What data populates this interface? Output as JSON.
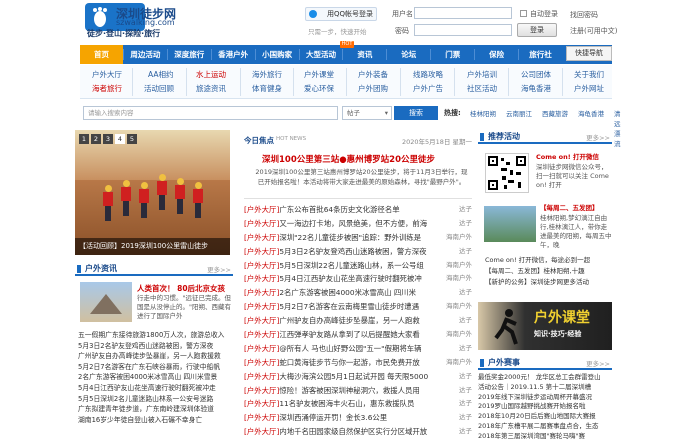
{
  "header": {
    "logo_name": "深圳徒步网",
    "logo_url": "szwalking.com",
    "slogan": "徒步·登山·探险·旅行",
    "qq_login": "用QQ帐号登录",
    "login_note": "只需一步，快速开始",
    "username_label": "用户名",
    "password_label": "密码",
    "auto_login": "自动登录",
    "login_btn": "登录",
    "find_pwd": "找回密码",
    "register": "注册(可用中文)"
  },
  "nav": {
    "items": [
      "首页",
      "周边活动",
      "深度旅行",
      "香港户外",
      "小国购家",
      "大型活动",
      "资讯",
      "论坛",
      "门票",
      "保险",
      "旅行社"
    ],
    "hot_badge": "HOT",
    "quick": "快捷导航"
  },
  "subnav": {
    "c1": [
      "户外大厅",
      "海者旅行"
    ],
    "c2": [
      "AA相约",
      "活动回顾"
    ],
    "c3": [
      "水上运动",
      "旅途资讯"
    ],
    "c4": [
      "海外旅行",
      "体育健身"
    ],
    "c5": [
      "户外课堂",
      "爱心环保"
    ],
    "c6": [
      "户外装备",
      "户外团购"
    ],
    "c7": [
      "线路攻略",
      "户外广告"
    ],
    "c8": [
      "户外培训",
      "社区活动"
    ],
    "c9": [
      "公司团体",
      "海龟香港"
    ],
    "c10": [
      "关于我们",
      "户外网址"
    ]
  },
  "search": {
    "placeholder": "请输入搜索内容",
    "select": "帖子",
    "button": "搜索",
    "hot_label": "热搜:",
    "hot": [
      "桂林阳朔",
      "云南丽江",
      "西藏旅游",
      "海龟香港",
      "清远漂流"
    ]
  },
  "slideshow": {
    "pages": [
      "1",
      "2",
      "3",
      "4",
      "5"
    ],
    "caption": "【活动回顾】2019深圳100公里雷山徒步"
  },
  "outdoor_news": {
    "title": "户外资讯",
    "more": "更多>>",
    "featured_title": "人类首次！ 80后北京女孩",
    "featured_sum": "行走中的习惯。\"远征已完成。但国是从没停止的。\"阳朔、西藏有进行了国际户外",
    "list": [
      "五一假期广东接待旅游1800万人次，旅游总收入",
      "5月3日2名驴友登鸡西山迷路被困，警方深夜",
      "广州驴友自办高峰徒步坠暴崖，另一人跑救援救",
      "5月2日7名游客在广东石峡谷暴雨，行驶中船帆",
      "2名广东游客被困4000米冰雪高山 四川米雪景",
      "5月4日江西驴友山花坐高速行驶时翻死被冲走",
      "5月5日深圳2名儿童迷路山林系一公安号迷路",
      "广东拟建青年徒步道，广东南岭建深圳体验道",
      "湖南16岁少年徒自登山被入石碾不幸身亡"
    ]
  },
  "focus": {
    "title": "今日焦点",
    "hot": "HOT NEWS",
    "date": "2020年5月18日 星期一",
    "headline": "深圳100公里第三站●惠州博罗站20公里徒步",
    "summary": "2019深圳100公里第三站惠州博罗站20公里徒步，将于11月3日举行，现已开始报名啦！本活动将带大家走进最美的原始森林，寻找\"最野户外\"。",
    "list": [
      {
        "tag": "[户外大厅]",
        "text": "广东公布首批64条历史文化游径名单",
        "src": "达子"
      },
      {
        "tag": "[户外大厅]",
        "text": "又一海边打卡地，风景绝美，但不方便，前海",
        "src": "达子"
      },
      {
        "tag": "[户外大厅]",
        "text": "深圳\"22名儿童徒步被困\"追踪：野外训练是",
        "src": "海南户外"
      },
      {
        "tag": "[户外大厅]",
        "text": "5月3日2名驴友登鸡西山迷路被困，警方深夜",
        "src": "达子"
      },
      {
        "tag": "[户外大厅]",
        "text": "5月5日深圳22名儿童迷路山林，系一公号组",
        "src": "海南户外"
      },
      {
        "tag": "[户外大厅]",
        "text": "5月4日江西驴友山花坐高速行驶时翻死被冲",
        "src": "海南户外"
      },
      {
        "tag": "[户外大厅]",
        "text": "2名广东游客被困4000米冰雪高山 四川米",
        "src": "达子"
      },
      {
        "tag": "[户外大厅]",
        "text": "5月2日7名游客在云南梅里雪山徒步时遭遇",
        "src": "海南户外"
      },
      {
        "tag": "[户外大厅]",
        "text": "广州驴友自办高峰徒步坠暴崖，另一人跑救",
        "src": "达子"
      },
      {
        "tag": "[户外大厅]",
        "text": "江西弹孝驴友路从拿到了以后提醒她大家看",
        "src": "海南户外"
      },
      {
        "tag": "[户外大厅]",
        "text": "@所有人 马也山好野公园\"五一\"假期将车辆",
        "src": "达子"
      },
      {
        "tag": "[户外大厅]",
        "text": "蛇口黄海徒步节与你一起游，市民免费开放",
        "src": "海南户外"
      },
      {
        "tag": "[户外大厅]",
        "text": "大梅沙海滨公园5月1日起试开园 每天限5000",
        "src": "达子"
      },
      {
        "tag": "[户外大厅]",
        "text": "惊险！游客被困深圳神秘洞穴，救援人员用",
        "src": "达子"
      },
      {
        "tag": "[户外大厅]",
        "text": "11名驴友被困海丰火石山，惠东救援队员",
        "src": "达子"
      },
      {
        "tag": "[户外大厅]",
        "text": "深圳西涌停运开罚！金长3.6公里",
        "src": "达子"
      },
      {
        "tag": "[户外大厅]",
        "text": "内地千名田园家级自然保护区实行分区域开放",
        "src": "达子"
      }
    ]
  },
  "recommend": {
    "title": "推荐活动",
    "more": "更多>>",
    "qr_title": "Come on! 打开微信",
    "qr_text": "深圳徒步网微信公众号，扫一扫就可以关注 Come on! 打开",
    "act_title": "【每周二、五发团】",
    "act_text": "桂林阳朔,梦幻漓江自由行,桂林漓江人，带你走进最美的阳朔，每周五中午，晚",
    "list": [
      "Come on!  打开微信，每途必到一超",
      "【每周二、五发团】桂林阳朔,十趣",
      "【新护的公务】深圳徒步网更多活动"
    ]
  },
  "banner": {
    "title": "户外课堂",
    "sub": "知识·技巧·经验"
  },
  "events": {
    "title": "户外赛事",
    "more": "更多>>",
    "list": [
      "最低奖金2000元！ 龙华区总工会群雷登山",
      "活动公告｜2019.11.5 第十二届深圳槽",
      "2019年线下深圳徒步运动周杯开幕盛况",
      "2019罗山国际越野挑战赛开始报名啦",
      "2018年10月20日后后赛山地国际大赛报",
      "2018年广东槽平展二届赛事盘点合，生态",
      "2018年第三届深圳湾国\"赛轮马嗨\"赛"
    ]
  }
}
